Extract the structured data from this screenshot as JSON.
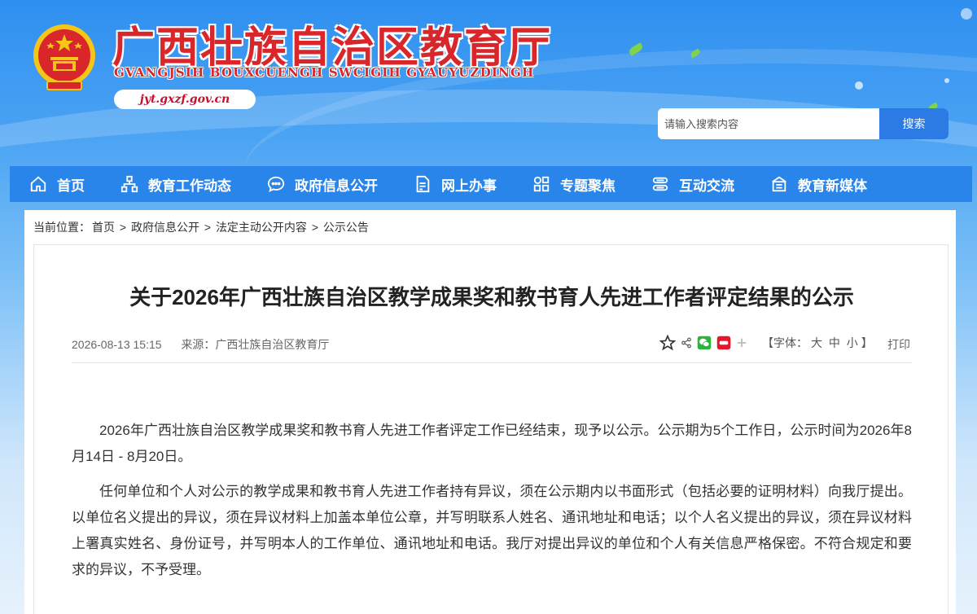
{
  "header": {
    "site_title": "广西壮族自治区教育厅",
    "site_subtitle": "GVANGJSIH BOUXCUENGH SWCIGIH GYAUYUZDINGH",
    "site_url": "jyt.gxzf.gov.cn",
    "brand_color": "#d9262a"
  },
  "search": {
    "placeholder": "请输入搜索内容",
    "button_label": "搜索"
  },
  "nav": {
    "items": [
      {
        "label": "首页",
        "icon": "home-icon"
      },
      {
        "label": "教育工作动态",
        "icon": "network-icon"
      },
      {
        "label": "政府信息公开",
        "icon": "chat-icon"
      },
      {
        "label": "网上办事",
        "icon": "document-icon"
      },
      {
        "label": "专题聚焦",
        "icon": "grid-icon"
      },
      {
        "label": "互动交流",
        "icon": "exchange-icon"
      },
      {
        "label": "教育新媒体",
        "icon": "media-icon"
      }
    ],
    "color": "#2a85ea"
  },
  "breadcrumb": {
    "prefix": "当前位置：",
    "items": [
      "首页",
      "政府信息公开",
      "法定主动公开内容",
      "公示公告"
    ],
    "separator": ">"
  },
  "article": {
    "title": "关于2026年广西壮族自治区教学成果奖和教书育人先进工作者评定结果的公示",
    "date": "2026-08-13 15:15",
    "source_label": "来源：",
    "source": "广西壮族自治区教育厅",
    "font_label_open": "【字体：",
    "font_large": "大",
    "font_medium": "中",
    "font_small": "小",
    "font_label_close": "】",
    "print_label": "打印",
    "paragraphs": [
      "2026年广西壮族自治区教学成果奖和教书育人先进工作者评定工作已经结束，现予以公示。公示期为5个工作日，公示时间为2026年8月14日 - 8月20日。",
      "任何单位和个人对公示的教学成果和教书育人先进工作者持有异议，须在公示期内以书面形式（包括必要的证明材料）向我厅提出。以单位名义提出的异议，须在异议材料上加盖本单位公章，并写明联系人姓名、通讯地址和电话；以个人名义提出的异议，须在异议材料上署真实姓名、身份证号，并写明本人的工作单位、通讯地址和电话。我厅对提出异议的单位和个人有关信息严格保密。不符合规定和要求的异议，不予受理。"
    ]
  }
}
